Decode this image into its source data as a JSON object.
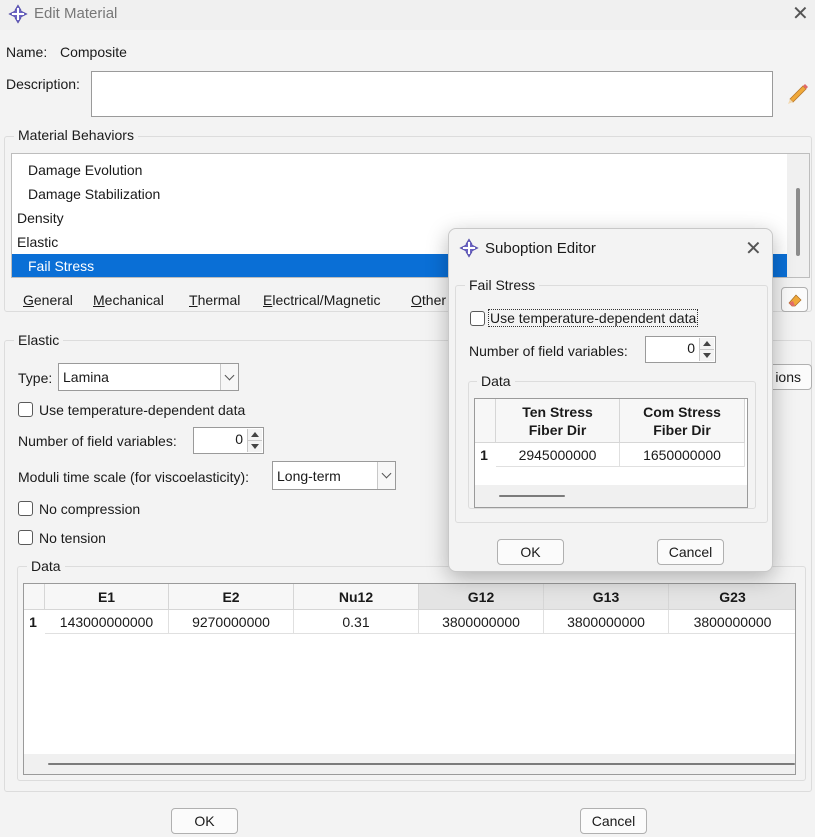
{
  "window": {
    "title": "Edit Material",
    "icon": "abaqus-cross-icon",
    "close_icon": "close-icon"
  },
  "name": {
    "label": "Name:",
    "value": "Composite"
  },
  "description": {
    "label": "Description:",
    "value": "",
    "edit_icon": "pencil-icon"
  },
  "behaviors": {
    "group_title": "Material Behaviors",
    "items": [
      {
        "label": "Damage Evolution",
        "indent": true,
        "selected": false
      },
      {
        "label": "Damage Stabilization",
        "indent": true,
        "selected": false
      },
      {
        "label": "Density",
        "indent": false,
        "selected": false
      },
      {
        "label": "Elastic",
        "indent": false,
        "selected": false
      },
      {
        "label": "Fail Stress",
        "indent": true,
        "selected": true
      }
    ],
    "delete_icon": "eraser-icon"
  },
  "menubar": {
    "items": [
      {
        "label": "General",
        "mnemonic": "G"
      },
      {
        "label": "Mechanical",
        "mnemonic": "M"
      },
      {
        "label": "Thermal",
        "mnemonic": "T"
      },
      {
        "label": "Electrical/Magnetic",
        "mnemonic": "E"
      },
      {
        "label": "Other",
        "mnemonic": "O"
      }
    ]
  },
  "elastic": {
    "group_title": "Elastic",
    "type_label": "Type:",
    "type_value": "Lamina",
    "temp_dependent_label": "Use temperature-dependent data",
    "temp_dependent_checked": false,
    "field_vars_label": "Number of field variables:",
    "field_vars_value": "0",
    "moduli_label": "Moduli time scale (for viscoelasticity):",
    "moduli_value": "Long-term",
    "no_compression_label": "No compression",
    "no_compression_checked": false,
    "no_tension_label": "No tension",
    "no_tension_checked": false,
    "suboptions_button_partial": "ions",
    "data": {
      "group_title": "Data",
      "columns": [
        "E1",
        "E2",
        "Nu12",
        "G12",
        "G13",
        "G23"
      ],
      "rows": [
        {
          "index": "1",
          "cells": [
            "143000000000",
            "9270000000",
            "0.31",
            "3800000000",
            "3800000000",
            "3800000000"
          ]
        }
      ]
    }
  },
  "buttons": {
    "ok": "OK",
    "cancel": "Cancel"
  },
  "suboption": {
    "title": "Suboption Editor",
    "icon": "abaqus-cross-icon",
    "close_icon": "close-icon",
    "group_title": "Fail Stress",
    "temp_dependent_label": "Use temperature-dependent data",
    "temp_dependent_checked": false,
    "field_vars_label": "Number of field variables:",
    "field_vars_value": "0",
    "data": {
      "group_title": "Data",
      "columns": [
        {
          "line1": "Ten Stress",
          "line2": "Fiber Dir"
        },
        {
          "line1": "Com Stress",
          "line2": "Fiber Dir"
        }
      ],
      "rows": [
        {
          "index": "1",
          "cells": [
            "2945000000",
            "1650000000"
          ]
        }
      ]
    },
    "ok": "OK",
    "cancel": "Cancel"
  },
  "colors": {
    "selection": "#0a6fd6",
    "background": "#f3f3f3",
    "accent_pencil": "#e8a33d"
  }
}
